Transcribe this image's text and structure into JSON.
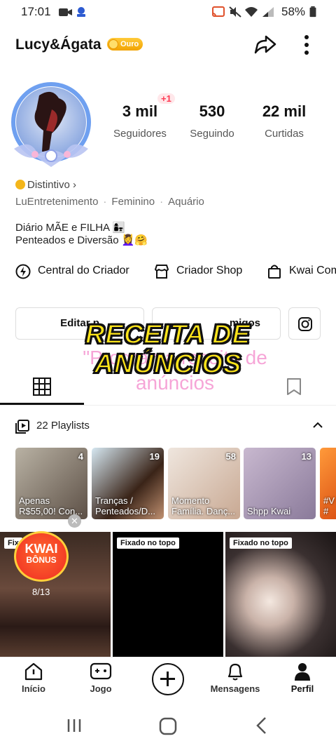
{
  "status_bar": {
    "time": "17:01",
    "battery_percent": "58%"
  },
  "header": {
    "username": "Lucy&Ágata",
    "level_badge": "Ouro",
    "share_icon": "share-arrow-icon",
    "more_icon": "more-vertical-icon"
  },
  "stats": {
    "followers_value": "3 mil",
    "followers_label": "Seguidores",
    "followers_delta": "+1",
    "following_value": "530",
    "following_label": "Seguindo",
    "likes_value": "22 mil",
    "likes_label": "Curtidas"
  },
  "profile": {
    "distintivo_label": "Distintivo",
    "tags": [
      "LuEntretenimento",
      "Feminino",
      "Aquário"
    ],
    "bio_line1": "Diário MÃE e FILHA 👩‍👧",
    "bio_line2": "Penteados e Diversão 💆‍♀️🤗"
  },
  "creator_links": [
    {
      "label": "Central do Criador",
      "icon": "lightning-circle-icon"
    },
    {
      "label": "Criador Shop",
      "icon": "store-icon"
    },
    {
      "label": "Kwai Com",
      "icon": "shopping-bag-icon"
    }
  ],
  "actions": {
    "edit_profile": "Editar p",
    "find_friends": "migos",
    "instagram_icon": "instagram-icon"
  },
  "overlay": {
    "title_line1": "RECEITA DE",
    "title_line2": "ANÚNCIOS",
    "bg_caption_line1": "\"Programa receita de",
    "bg_caption_line2": "anúncios"
  },
  "playlists": {
    "header": "22 Playlists",
    "items": [
      {
        "title": "Apenas R$55,00! Con...",
        "count": "4",
        "color": "#8a7a6a"
      },
      {
        "title": "Tranças / Penteados/D...",
        "count": "19",
        "color": "#a48878"
      },
      {
        "title": "Momento Família. Danç...",
        "count": "58",
        "color": "#d9c4b8"
      },
      {
        "title": "Shpp Kwai",
        "count": "13",
        "color": "#b0a0b6"
      },
      {
        "title": "#V ai #",
        "count": "",
        "color": "#ff7a1a"
      }
    ]
  },
  "videos": {
    "pinned_label": "Fixado no topo",
    "kwai_bonus_line1": "KWAI",
    "kwai_bonus_line2": "BÔNUS",
    "progress": "8/13",
    "first_pin_label": "Fix"
  },
  "bottom_nav": [
    {
      "label": "Início",
      "icon": "home-icon"
    },
    {
      "label": "Jogo",
      "icon": "gamepad-icon"
    },
    {
      "label": "",
      "icon": "add-icon"
    },
    {
      "label": "Mensagens",
      "icon": "bell-icon"
    },
    {
      "label": "Perfil",
      "icon": "person-icon"
    }
  ]
}
